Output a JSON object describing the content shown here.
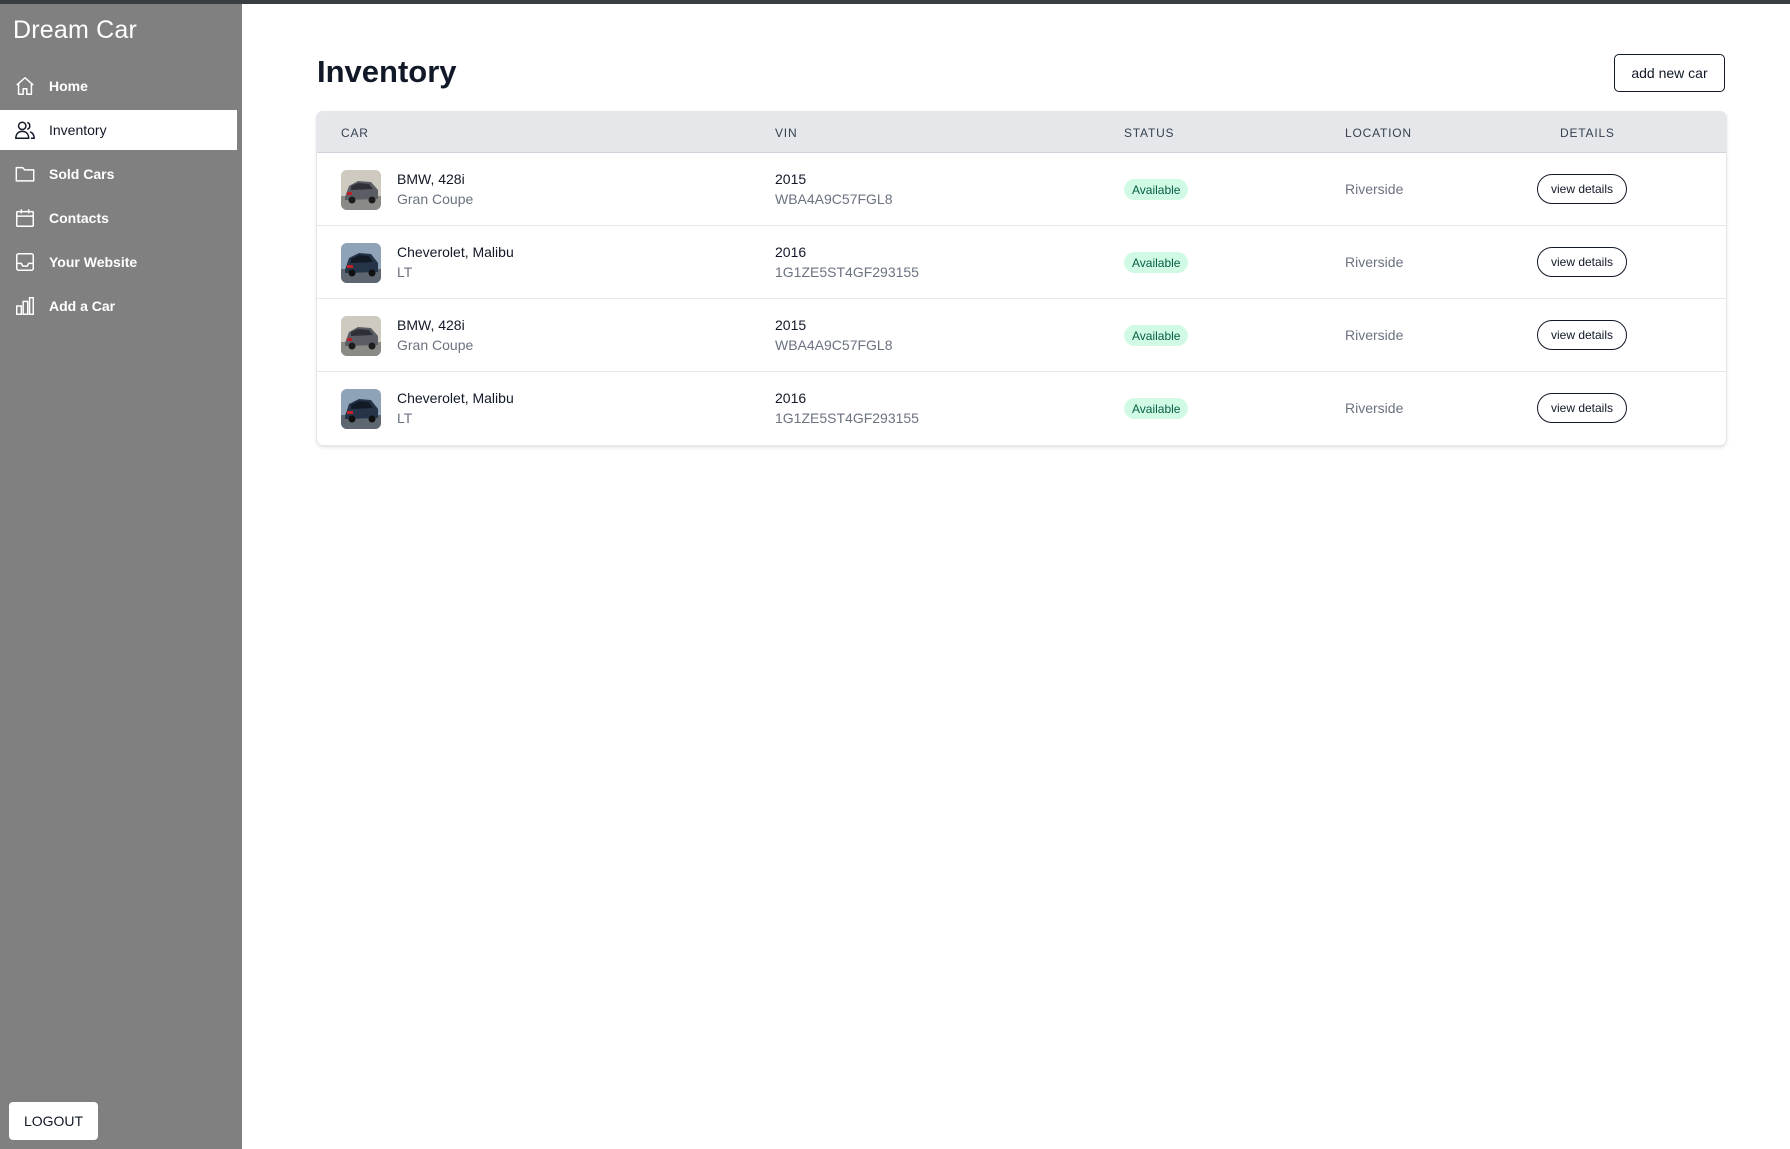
{
  "app": {
    "brand": "Dream Car"
  },
  "sidebar": {
    "items": [
      {
        "label": "Home",
        "icon": "home-icon",
        "active": false
      },
      {
        "label": "Inventory",
        "icon": "users-icon",
        "active": true
      },
      {
        "label": "Sold Cars",
        "icon": "folder-icon",
        "active": false
      },
      {
        "label": "Contacts",
        "icon": "calendar-icon",
        "active": false
      },
      {
        "label": "Your Website",
        "icon": "inbox-icon",
        "active": false
      },
      {
        "label": "Add a Car",
        "icon": "chart-bar-icon",
        "active": false
      }
    ],
    "logout_label": "LOGOUT"
  },
  "main": {
    "title": "Inventory",
    "add_button_label": "add new car",
    "table": {
      "headers": {
        "car": "CAR",
        "vin": "VIN",
        "status": "STATUS",
        "location": "LOCATION",
        "details": "DETAILS"
      },
      "rows": [
        {
          "name": "BMW, 428i",
          "trim": "Gran Coupe",
          "year": "2015",
          "vin": "WBA4A9C57FGL8",
          "status": "Available",
          "location": "Riverside",
          "action": "view details",
          "thumb": "silver-car"
        },
        {
          "name": "Cheverolet, Malibu",
          "trim": "LT",
          "year": "2016",
          "vin": "1G1ZE5ST4GF293155",
          "status": "Available",
          "location": "Riverside",
          "action": "view details",
          "thumb": "blue-car"
        },
        {
          "name": "BMW, 428i",
          "trim": "Gran Coupe",
          "year": "2015",
          "vin": "WBA4A9C57FGL8",
          "status": "Available",
          "location": "Riverside",
          "action": "view details",
          "thumb": "silver-car"
        },
        {
          "name": "Cheverolet, Malibu",
          "trim": "LT",
          "year": "2016",
          "vin": "1G1ZE5ST4GF293155",
          "status": "Available",
          "location": "Riverside",
          "action": "view details",
          "thumb": "blue-car"
        }
      ]
    }
  },
  "colors": {
    "sidebar_bg": "#808080",
    "status_bg": "#d1fae5",
    "status_text": "#065f46",
    "header_bg": "#e5e7eb"
  }
}
